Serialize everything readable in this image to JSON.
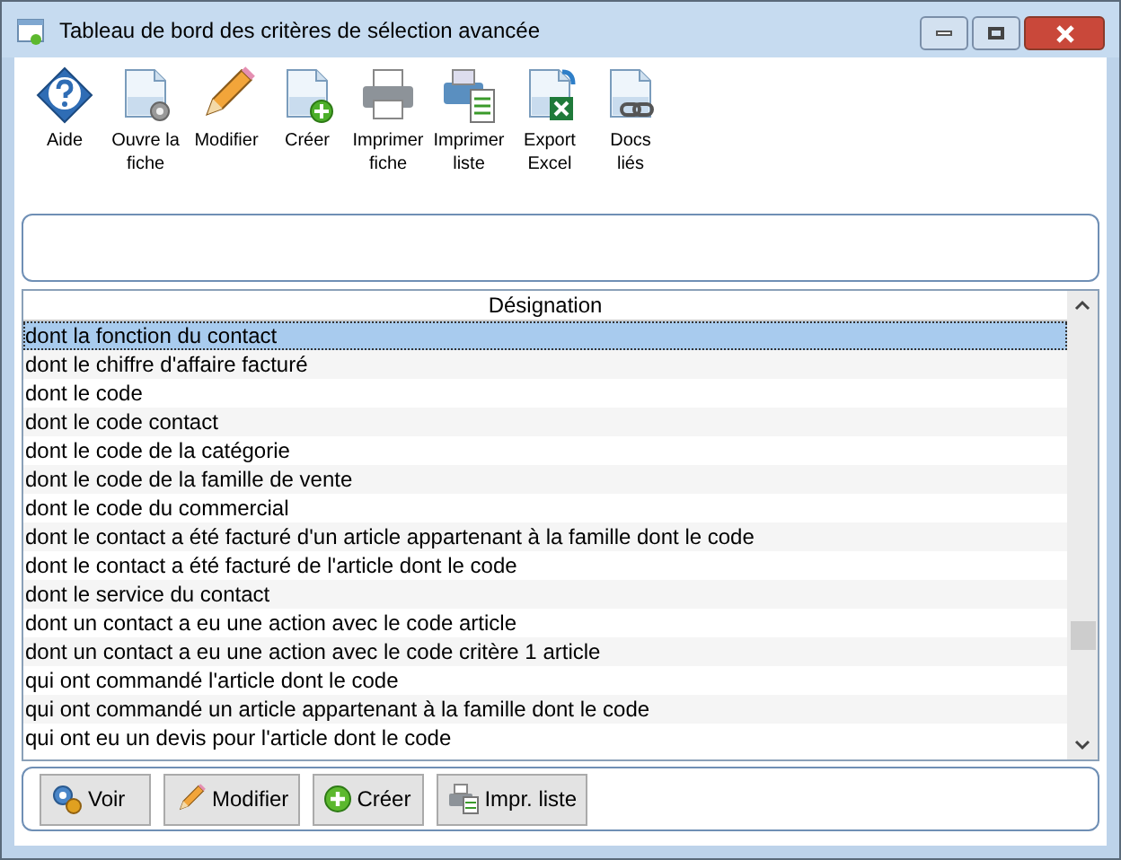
{
  "window": {
    "title": "Tableau de bord des critères de sélection avancée"
  },
  "toolbar": [
    {
      "kind": "help",
      "label": "Aide"
    },
    {
      "kind": "open",
      "label": "Ouvre la fiche"
    },
    {
      "kind": "edit",
      "label": "Modifier"
    },
    {
      "kind": "create",
      "label": "Créer"
    },
    {
      "kind": "print",
      "label": "Imprimer fiche"
    },
    {
      "kind": "printlist",
      "label": "Imprimer liste"
    },
    {
      "kind": "excel",
      "label": "Export Excel"
    },
    {
      "kind": "docs",
      "label": "Docs liés"
    }
  ],
  "table": {
    "columns": [
      "Désignation"
    ],
    "rows": [
      {
        "text": "dont la fonction du contact",
        "selected": true
      },
      {
        "text": "dont le chiffre d'affaire facturé",
        "selected": false
      },
      {
        "text": "dont le code",
        "selected": false
      },
      {
        "text": "dont le code contact",
        "selected": false
      },
      {
        "text": "dont le code de la catégorie",
        "selected": false
      },
      {
        "text": "dont le code de la famille de vente",
        "selected": false
      },
      {
        "text": "dont le code du commercial",
        "selected": false
      },
      {
        "text": "dont le contact a été facturé d'un article appartenant à la famille dont le code",
        "selected": false
      },
      {
        "text": "dont le contact a été facturé de l'article dont le code",
        "selected": false
      },
      {
        "text": "dont le service du contact",
        "selected": false
      },
      {
        "text": "dont un contact a eu une action avec le code article",
        "selected": false
      },
      {
        "text": "dont un contact a eu une action avec le code critère 1 article",
        "selected": false
      },
      {
        "text": "qui ont commandé l'article dont le code",
        "selected": false
      },
      {
        "text": "qui ont commandé un article appartenant à la famille dont le code",
        "selected": false
      },
      {
        "text": "qui ont eu un devis pour l'article dont le code",
        "selected": false
      }
    ]
  },
  "buttons": [
    {
      "kind": "view",
      "label": "Voir"
    },
    {
      "kind": "edit",
      "label": "Modifier"
    },
    {
      "kind": "create",
      "label": "Créer"
    },
    {
      "kind": "printlist",
      "label": "Impr. liste"
    }
  ]
}
